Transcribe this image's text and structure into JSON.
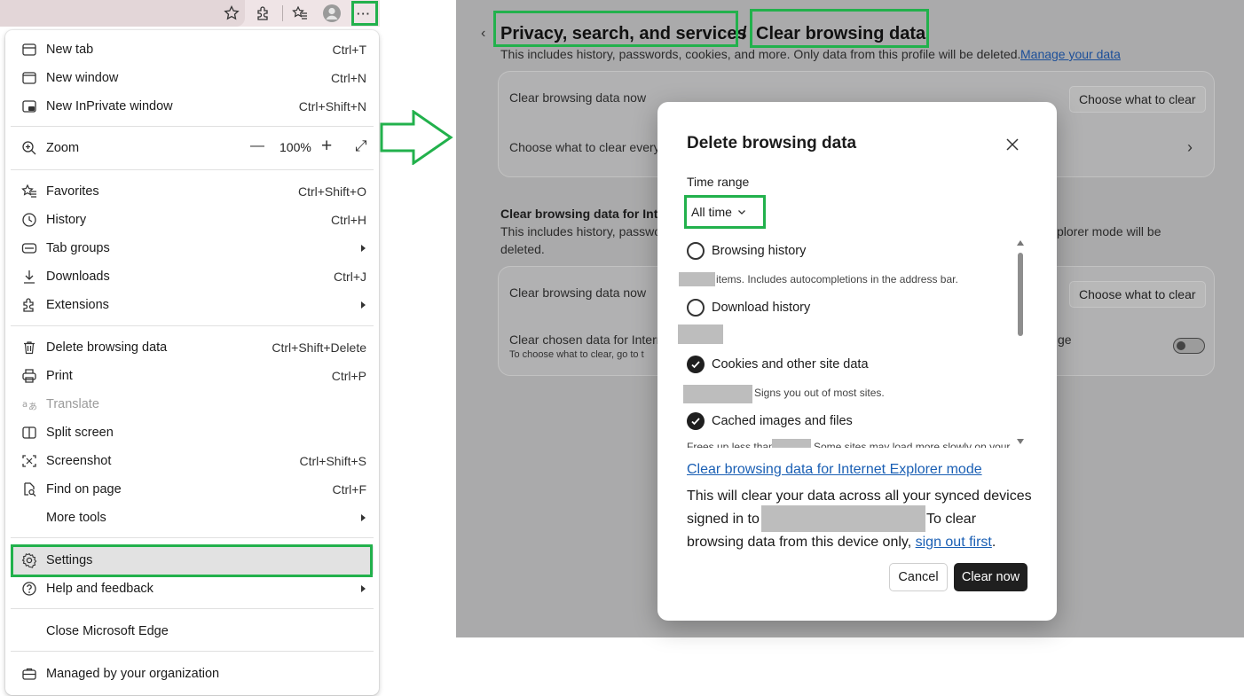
{
  "colors": {
    "highlight": "#22b14c",
    "link": "#1a5fb4",
    "primary_button": "#1f1f1f",
    "dimmed_background": "#aaaaab"
  },
  "toolbar": {
    "icons": [
      "star-icon",
      "extensions-icon",
      "favorites-icon",
      "profile-icon",
      "more-icon"
    ],
    "more_label": "···"
  },
  "menu": {
    "items": [
      {
        "label": "New tab",
        "shortcut": "Ctrl+T",
        "icon": "new-tab-icon"
      },
      {
        "label": "New window",
        "shortcut": "Ctrl+N",
        "icon": "new-window-icon"
      },
      {
        "label": "New InPrivate window",
        "shortcut": "Ctrl+Shift+N",
        "icon": "inprivate-icon"
      },
      {
        "label": "Zoom",
        "icon": "zoom-icon"
      },
      {
        "label": "Favorites",
        "shortcut": "Ctrl+Shift+O",
        "icon": "favorites-icon"
      },
      {
        "label": "History",
        "shortcut": "Ctrl+H",
        "icon": "history-icon"
      },
      {
        "label": "Tab groups",
        "icon": "tab-groups-icon",
        "submenu": true
      },
      {
        "label": "Downloads",
        "shortcut": "Ctrl+J",
        "icon": "downloads-icon"
      },
      {
        "label": "Extensions",
        "icon": "extensions-icon",
        "submenu": true
      },
      {
        "label": "Delete browsing data",
        "shortcut": "Ctrl+Shift+Delete",
        "icon": "trash-icon"
      },
      {
        "label": "Print",
        "shortcut": "Ctrl+P",
        "icon": "print-icon"
      },
      {
        "label": "Translate",
        "icon": "translate-icon",
        "disabled": true
      },
      {
        "label": "Split screen",
        "icon": "split-screen-icon"
      },
      {
        "label": "Screenshot",
        "shortcut": "Ctrl+Shift+S",
        "icon": "screenshot-icon"
      },
      {
        "label": "Find on page",
        "shortcut": "Ctrl+F",
        "icon": "find-icon"
      },
      {
        "label": "More tools",
        "submenu": true
      },
      {
        "label": "Settings",
        "icon": "gear-icon",
        "highlighted": true
      },
      {
        "label": "Help and feedback",
        "icon": "help-icon",
        "submenu": true
      },
      {
        "label": "Close Microsoft Edge"
      },
      {
        "label": "Managed by your organization",
        "icon": "briefcase-icon"
      }
    ],
    "zoom": {
      "minus": "—",
      "value": "100%",
      "plus": "+",
      "fullscreen": "⤢"
    }
  },
  "settings": {
    "breadcrumb": {
      "parent": "Privacy, search, and services",
      "separator": "/",
      "current": "Clear browsing data"
    },
    "description": "This includes history, passwords, cookies, and more. Only data from this profile will be deleted.",
    "manage_link": "Manage your data",
    "card1": {
      "row1_label": "Clear browsing data now",
      "row1_button": "Choose what to clear",
      "row2_label": "Choose what to clear every"
    },
    "ie_section": {
      "heading": "Clear browsing data for Int",
      "desc_line1": "This includes history, passwo",
      "desc_tail": "plorer mode will be",
      "desc_line2": "deleted."
    },
    "card2": {
      "row1_label": "Clear browsing data now",
      "row1_button": "Choose what to clear",
      "row2_label": "Clear chosen data for Intern",
      "row2_sub": "To choose what to clear, go to t",
      "row2_tail": "ge"
    }
  },
  "dialog": {
    "title": "Delete browsing data",
    "close_icon": "close-icon",
    "time_range_label": "Time range",
    "time_range_value": "All time",
    "items": [
      {
        "label": "Browsing history",
        "checked": false,
        "sub": "items. Includes autocompletions in the address bar."
      },
      {
        "label": "Download history",
        "checked": false,
        "sub": ""
      },
      {
        "label": "Cookies and other site data",
        "checked": true,
        "sub": "Signs you out of most sites."
      },
      {
        "label": "Cached images and files",
        "checked": true,
        "sub_a": "Frees up less than",
        "sub_b": "Some sites may load more slowly on your"
      }
    ],
    "ie_link": "Clear browsing data for Internet Explorer mode",
    "sync_line1": "This will clear your data across all your synced devices",
    "sync_line2_a": "signed in to",
    "sync_line2_b": "To clear",
    "sync_line3": "browsing data from this device only,",
    "sign_out_link": "sign out first",
    "sync_period": ".",
    "cancel": "Cancel",
    "clear_now": "Clear now"
  }
}
